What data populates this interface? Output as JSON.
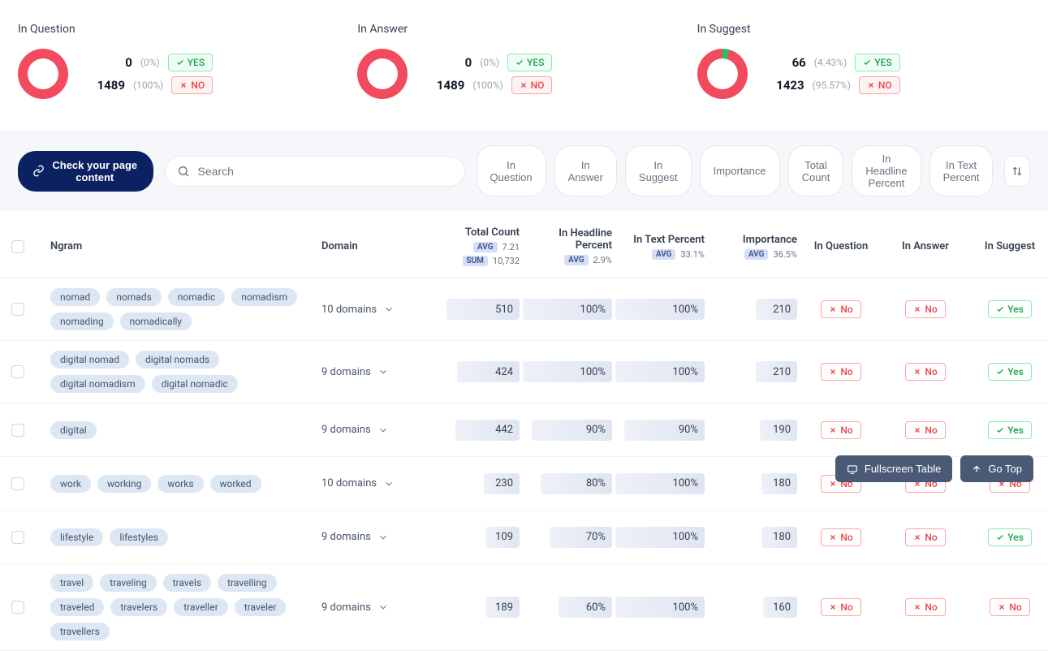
{
  "stats": [
    {
      "title": "In Question",
      "yes_count": "0",
      "yes_pct": "(0%)",
      "no_count": "1489",
      "no_pct": "(100%)",
      "yes_label": "YES",
      "no_label": "NO",
      "donut_yes_deg": 0
    },
    {
      "title": "In Answer",
      "yes_count": "0",
      "yes_pct": "(0%)",
      "no_count": "1489",
      "no_pct": "(100%)",
      "yes_label": "YES",
      "no_label": "NO",
      "donut_yes_deg": 0
    },
    {
      "title": "In Suggest",
      "yes_count": "66",
      "yes_pct": "(4.43%)",
      "no_count": "1423",
      "no_pct": "(95.57%)",
      "yes_label": "YES",
      "no_label": "NO",
      "donut_yes_deg": 16
    }
  ],
  "toolbar": {
    "check_button": "Check your page content",
    "search_placeholder": "Search",
    "filters": [
      "In Question",
      "In Answer",
      "In Suggest",
      "Importance",
      "Total Count",
      "In Headline Percent",
      "In Text Percent"
    ]
  },
  "columns": {
    "ngram": "Ngram",
    "domain": "Domain",
    "total_count": "Total Count",
    "total_count_avg_label": "AVG",
    "total_count_avg": "7.21",
    "total_count_sum_label": "SUM",
    "total_count_sum": "10,732",
    "in_headline": "In Headline Percent",
    "in_headline_avg_label": "AVG",
    "in_headline_avg": "2.9%",
    "in_text": "In Text Percent",
    "in_text_avg_label": "AVG",
    "in_text_avg": "33.1%",
    "importance": "Importance",
    "importance_avg_label": "AVG",
    "importance_avg": "36.5%",
    "in_question": "In Question",
    "in_answer": "In Answer",
    "in_suggest": "In Suggest"
  },
  "yn_labels": {
    "yes": "Yes",
    "no": "No"
  },
  "rows": [
    {
      "tags": [
        "nomad",
        "nomads",
        "nomadic",
        "nomadism",
        "nomading",
        "nomadically"
      ],
      "domain": "10 domains",
      "total_count": "510",
      "total_count_w": 82,
      "headline": "100%",
      "headline_w": 100,
      "text": "100%",
      "text_w": 100,
      "importance": "210",
      "importance_w": 46,
      "q": "no",
      "a": "no",
      "s": "yes"
    },
    {
      "tags": [
        "digital nomad",
        "digital nomads",
        "digital nomadism",
        "digital nomadic"
      ],
      "domain": "9 domains",
      "total_count": "424",
      "total_count_w": 70,
      "headline": "100%",
      "headline_w": 100,
      "text": "100%",
      "text_w": 100,
      "importance": "210",
      "importance_w": 46,
      "q": "no",
      "a": "no",
      "s": "yes"
    },
    {
      "tags": [
        "digital"
      ],
      "domain": "9 domains",
      "total_count": "442",
      "total_count_w": 72,
      "headline": "90%",
      "headline_w": 90,
      "text": "90%",
      "text_w": 90,
      "importance": "190",
      "importance_w": 42,
      "q": "no",
      "a": "no",
      "s": "yes"
    },
    {
      "tags": [
        "work",
        "working",
        "works",
        "worked"
      ],
      "domain": "10 domains",
      "total_count": "230",
      "total_count_w": 40,
      "headline": "80%",
      "headline_w": 80,
      "text": "100%",
      "text_w": 100,
      "importance": "180",
      "importance_w": 40,
      "q": "no",
      "a": "no",
      "s": "no"
    },
    {
      "tags": [
        "lifestyle",
        "lifestyles"
      ],
      "domain": "9 domains",
      "total_count": "109",
      "total_count_w": 22,
      "headline": "70%",
      "headline_w": 70,
      "text": "100%",
      "text_w": 100,
      "importance": "180",
      "importance_w": 40,
      "q": "no",
      "a": "no",
      "s": "yes"
    },
    {
      "tags": [
        "travel",
        "traveling",
        "travels",
        "travelling",
        "traveled",
        "travelers",
        "traveller",
        "traveler",
        "travellers"
      ],
      "domain": "9 domains",
      "total_count": "189",
      "total_count_w": 34,
      "headline": "60%",
      "headline_w": 60,
      "text": "100%",
      "text_w": 100,
      "importance": "160",
      "importance_w": 36,
      "q": "no",
      "a": "no",
      "s": "no"
    }
  ],
  "float": {
    "fullscreen": "Fullscreen Table",
    "gotop": "Go Top"
  }
}
